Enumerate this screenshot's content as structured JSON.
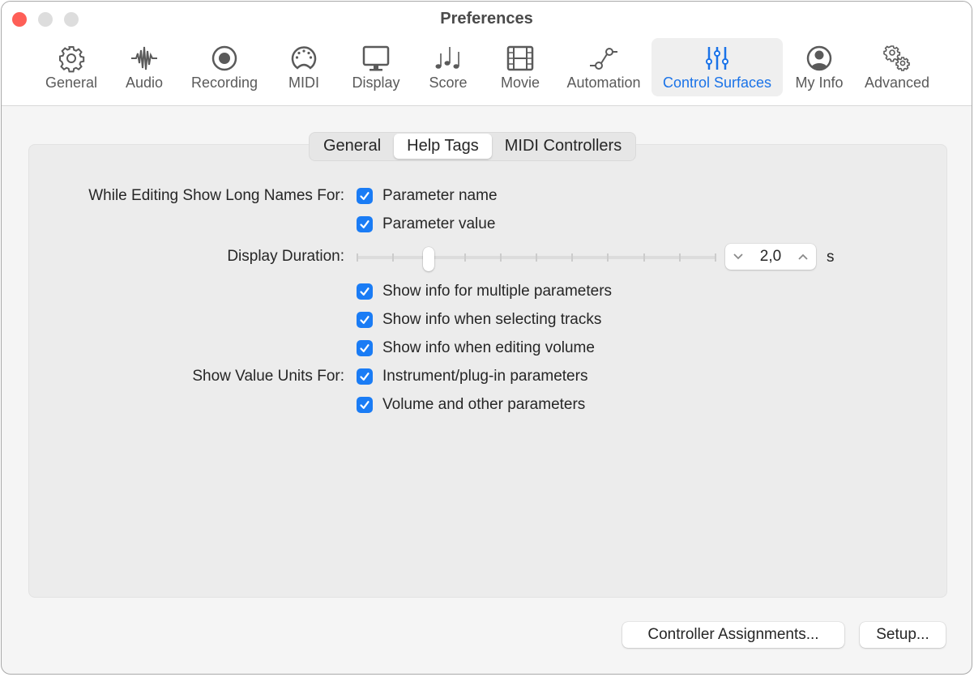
{
  "window": {
    "title": "Preferences",
    "accent_color": "#1a73e8",
    "checkbox_color": "#1a7cf5"
  },
  "toolbar": {
    "items": [
      {
        "label": "General",
        "icon": "gear-icon",
        "active": false
      },
      {
        "label": "Audio",
        "icon": "waveform-icon",
        "active": false
      },
      {
        "label": "Recording",
        "icon": "record-icon",
        "active": false
      },
      {
        "label": "MIDI",
        "icon": "midi-port-icon",
        "active": false
      },
      {
        "label": "Display",
        "icon": "monitor-icon",
        "active": false
      },
      {
        "label": "Score",
        "icon": "music-notes-icon",
        "active": false
      },
      {
        "label": "Movie",
        "icon": "film-icon",
        "active": false
      },
      {
        "label": "Automation",
        "icon": "automation-curve-icon",
        "active": false
      },
      {
        "label": "Control Surfaces",
        "icon": "sliders-icon",
        "active": true
      },
      {
        "label": "My Info",
        "icon": "user-icon",
        "active": false
      },
      {
        "label": "Advanced",
        "icon": "gears-icon",
        "active": false
      }
    ]
  },
  "tabs": [
    {
      "label": "General",
      "active": false
    },
    {
      "label": "Help Tags",
      "active": true
    },
    {
      "label": "MIDI Controllers",
      "active": false
    }
  ],
  "form": {
    "long_names_label": "While Editing Show Long Names For:",
    "parameter_name": {
      "label": "Parameter name",
      "checked": true
    },
    "parameter_value": {
      "label": "Parameter value",
      "checked": true
    },
    "display_duration_label": "Display Duration:",
    "display_duration": {
      "value": "2,0",
      "unit": "s",
      "slider_position_fraction": 0.2,
      "tick_count": 11
    },
    "show_info_multiple": {
      "label": "Show info for multiple parameters",
      "checked": true
    },
    "show_info_tracks": {
      "label": "Show info when selecting tracks",
      "checked": true
    },
    "show_info_volume": {
      "label": "Show info when editing volume",
      "checked": true
    },
    "value_units_label": "Show Value Units For:",
    "units_instrument": {
      "label": "Instrument/plug-in parameters",
      "checked": true
    },
    "units_volume": {
      "label": "Volume and other parameters",
      "checked": true
    }
  },
  "buttons": {
    "controller_assignments": "Controller Assignments...",
    "setup": "Setup..."
  }
}
